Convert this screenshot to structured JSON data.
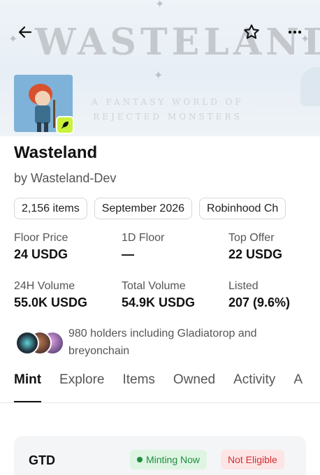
{
  "banner": {
    "title": "WASTELAND",
    "subtitle": "A FANTASY WORLD OF REJECTED MONSTERS"
  },
  "collection": {
    "name": "Wasteland",
    "creator": "by Wasteland-Dev"
  },
  "chips": [
    "2,156 items",
    "September 2026",
    "Robinhood Ch"
  ],
  "stats": {
    "floor_price": {
      "label": "Floor Price",
      "value": "24 USDG"
    },
    "one_day_floor": {
      "label": "1D Floor",
      "value": "—"
    },
    "top_offer": {
      "label": "Top Offer",
      "value": "22 USDG"
    },
    "volume_24h": {
      "label": "24H Volume",
      "value": "55.0K USDG"
    },
    "total_volume": {
      "label": "Total Volume",
      "value": "54.9K USDG"
    },
    "listed": {
      "label": "Listed",
      "value": "207 (9.6%)"
    }
  },
  "holders": {
    "text": "980 holders including Gladiatorop and breyonchain"
  },
  "tabs": [
    {
      "label": "Mint",
      "active": true
    },
    {
      "label": "Explore",
      "active": false
    },
    {
      "label": "Items",
      "active": false
    },
    {
      "label": "Owned",
      "active": false
    },
    {
      "label": "Activity",
      "active": false
    },
    {
      "label": "A",
      "active": false
    }
  ],
  "mint_phase": {
    "name": "GTD",
    "status": "Minting Now",
    "eligibility": "Not Eligible"
  },
  "colors": {
    "accent_verified": "#c9f23a",
    "status_green": "#1e8e3e",
    "status_red": "#d32f2f"
  },
  "icons": {
    "back": "arrow-left-icon",
    "favorite": "star-outline-icon",
    "more": "more-horizontal-icon",
    "verified": "feather-badge-icon"
  }
}
